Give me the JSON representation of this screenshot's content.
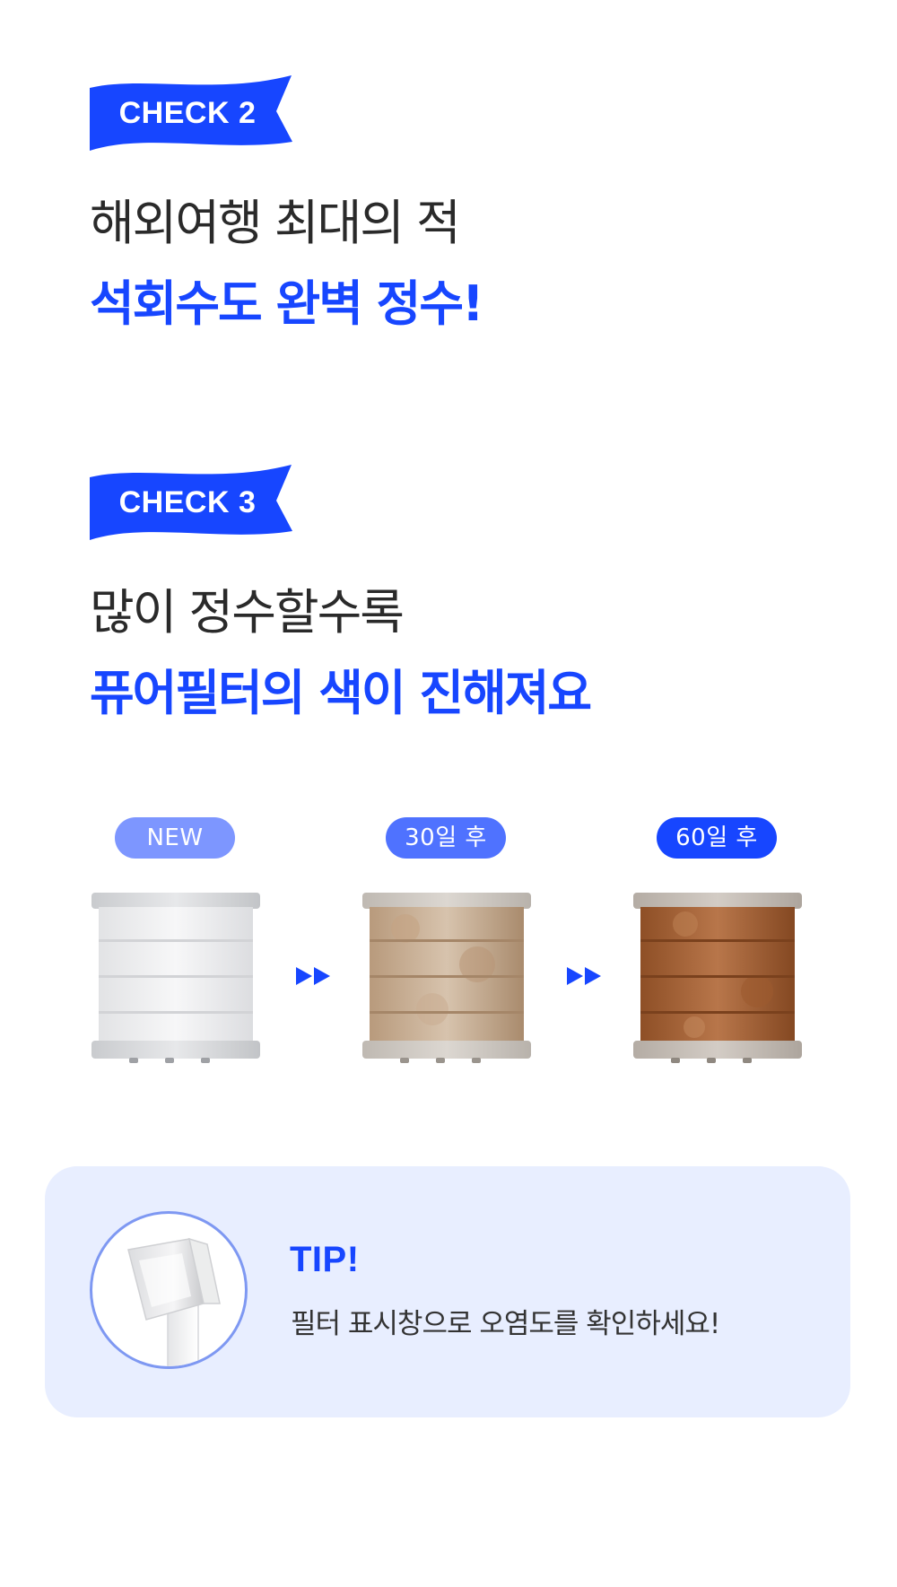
{
  "check2": {
    "badge": "CHECK 2",
    "headline_line1": "해외여행 최대의 적",
    "headline_line2": "석회수도 완벽 정수!"
  },
  "check3": {
    "badge": "CHECK 3",
    "headline_line1": "많이 정수할수록",
    "headline_line2": "퓨어필터의 색이 진해져요"
  },
  "stages": [
    {
      "label": "NEW",
      "pill_color": "#7d96ff",
      "filter": "clean-filter"
    },
    {
      "label": "30일 후",
      "pill_color": "#4f72ff",
      "filter": "stained-filter"
    },
    {
      "label": "60일 후",
      "pill_color": "#1746ff",
      "filter": "rusty-filter"
    }
  ],
  "tip": {
    "title": "TIP!",
    "text": "필터 표시창으로 오염도를 확인하세요!",
    "icon": "shower-head-filter-window-icon"
  },
  "colors": {
    "accent_blue": "#1746ff",
    "tip_background": "#e8eeff",
    "heading_dark": "#2a2a2a"
  }
}
